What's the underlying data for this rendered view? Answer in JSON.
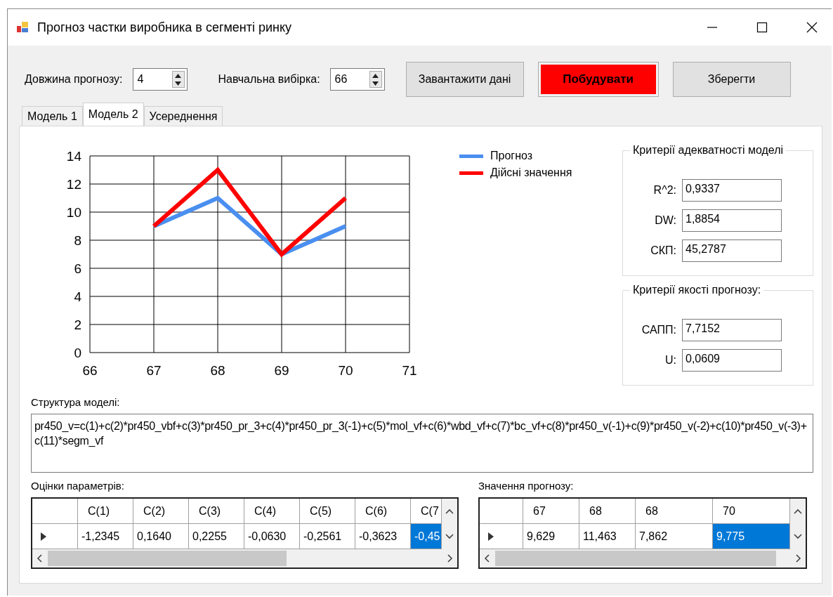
{
  "window": {
    "title": "Прогноз частки виробника в сегменті ринку"
  },
  "toolbar": {
    "spinners": [
      {
        "label": "Довжина прогнозу:",
        "value": "4"
      },
      {
        "label": "Навчальна вибірка:",
        "value": "66"
      }
    ],
    "buttons": [
      {
        "label": "Завантажити дані",
        "kind": "normal"
      },
      {
        "label": "Побудувати",
        "kind": "primary"
      },
      {
        "label": "Зберегти",
        "kind": "normal"
      }
    ]
  },
  "tabs": [
    {
      "label": "Модель 1",
      "selected": false
    },
    {
      "label": "Модель 2",
      "selected": true
    },
    {
      "label": "Усереднення",
      "selected": false
    }
  ],
  "chart_data": {
    "type": "line",
    "x": [
      67,
      68,
      69,
      70
    ],
    "series": [
      {
        "name": "Прогноз",
        "color": "#4a8ff0",
        "values": [
          9,
          11,
          7,
          9
        ]
      },
      {
        "name": "Дійсні значення",
        "color": "#ff0000",
        "values": [
          9,
          13,
          7,
          11
        ]
      }
    ],
    "grid": true,
    "legend": true,
    "xlim": [
      66,
      71
    ],
    "ylim": [
      0,
      14
    ],
    "xticks": [
      66,
      67,
      68,
      69,
      70,
      71
    ],
    "yticks": [
      0,
      2,
      4,
      6,
      8,
      10,
      12,
      14
    ]
  },
  "groups": [
    {
      "title": "Критерії адекватності моделі",
      "fields": [
        {
          "label": "R^2:",
          "value": "0,9337"
        },
        {
          "label": "DW:",
          "value": "1,8854"
        },
        {
          "label": "СКП:",
          "value": "45,2787"
        }
      ]
    },
    {
      "title": "Критерії якості прогнозу:",
      "fields": [
        {
          "label": "САПП:",
          "value": "7,7152"
        },
        {
          "label": "U:",
          "value": "0,0609"
        }
      ]
    }
  ],
  "structure": {
    "label": "Структура моделі:",
    "text": "pr450_v=c(1)+c(2)*pr450_vbf+c(3)*pr450_pr_3+c(4)*pr450_pr_3(-1)+c(5)*mol_vf+c(6)*wbd_vf+c(7)*bc_vf+c(8)*pr450_v(-1)+c(9)*pr450_v(-2)+c(10)*pr450_v(-3)+c(11)*segm_vf"
  },
  "grids": [
    {
      "label": "Оцінки параметрів:",
      "columns": [
        "C(1)",
        "C(2)",
        "C(3)",
        "C(4)",
        "C(5)",
        "C(6)",
        "C(7"
      ],
      "rows": [
        {
          "cells": [
            {
              "value": "-1,2345",
              "selected": false
            },
            {
              "value": "0,1640",
              "selected": false
            },
            {
              "value": "0,2255",
              "selected": false
            },
            {
              "value": "-0,0630",
              "selected": false
            },
            {
              "value": "-0,2561",
              "selected": false
            },
            {
              "value": "-0,3623",
              "selected": false
            },
            {
              "value": "-0,45",
              "selected": true
            }
          ]
        }
      ]
    },
    {
      "label": "Значення прогнозу:",
      "columns": [
        "67",
        "68",
        "68",
        "70"
      ],
      "rows": [
        {
          "cells": [
            {
              "value": "9,629",
              "selected": false
            },
            {
              "value": "11,463",
              "selected": false
            },
            {
              "value": "7,862",
              "selected": false
            },
            {
              "value": "9,775",
              "selected": true
            }
          ]
        }
      ]
    }
  ]
}
